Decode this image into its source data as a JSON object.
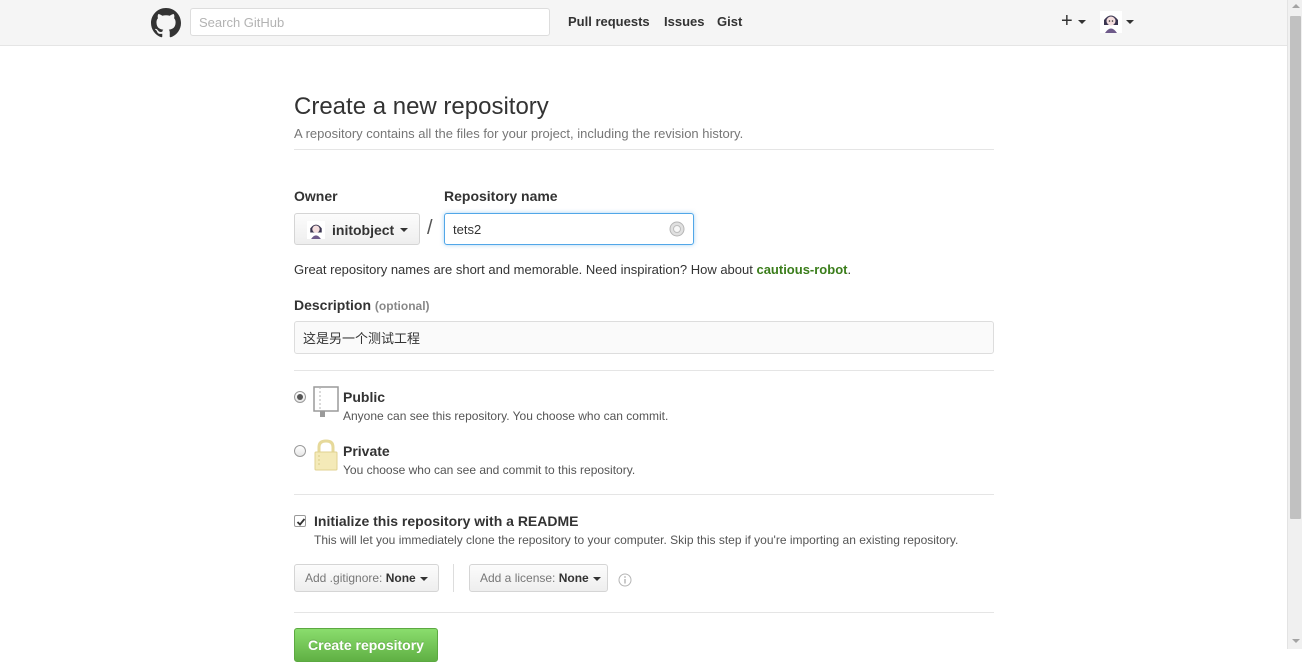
{
  "header": {
    "search_placeholder": "Search GitHub",
    "nav": [
      {
        "label": "Pull requests"
      },
      {
        "label": "Issues"
      },
      {
        "label": "Gist"
      }
    ],
    "new_menu_label": "+",
    "icons": [
      "github-logo-icon",
      "plus-icon",
      "avatar",
      "chevron-down-icon"
    ]
  },
  "page": {
    "title": "Create a new repository",
    "subtitle": "A repository contains all the files for your project, including the revision history."
  },
  "form": {
    "owner_label": "Owner",
    "owner_value": "initobject",
    "separator": "/",
    "repo_label": "Repository name",
    "repo_value": "tets2",
    "hint_text": "Great repository names are short and memorable. Need inspiration? How about ",
    "hint_suggestion": "cautious-robot",
    "hint_end": ".",
    "description_label": "Description",
    "description_optional": "(optional)",
    "description_value": "这是另一个测试工程",
    "visibility": [
      {
        "title": "Public",
        "description": "Anyone can see this repository. You choose who can commit.",
        "selected": true
      },
      {
        "title": "Private",
        "description": "You choose who can see and commit to this repository.",
        "selected": false
      }
    ],
    "readme": {
      "label": "Initialize this repository with a README",
      "description": "This will let you immediately clone the repository to your computer. Skip this step if you're importing an existing repository.",
      "checked": true
    },
    "gitignore": {
      "prefix": "Add .gitignore: ",
      "value": "None"
    },
    "license": {
      "prefix": "Add a license: ",
      "value": "None"
    },
    "submit_label": "Create repository"
  },
  "colors": {
    "accent_green": "#60b044",
    "link_green": "#3a7d1a",
    "focus_blue": "#51a7e8"
  }
}
